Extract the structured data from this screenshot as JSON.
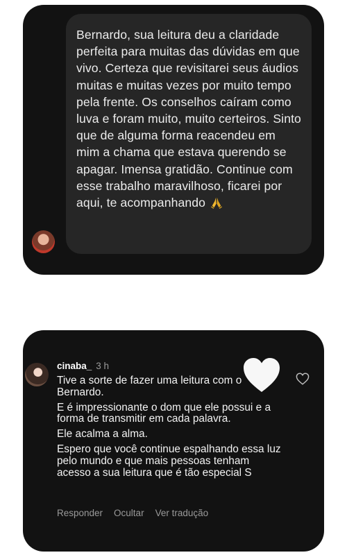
{
  "dm": {
    "message": "Bernardo, sua leitura deu a claridade perfeita para muitas das dúvidas em que vivo. Certeza que revisitarei seus áudios muitas e muitas vezes por muito tempo pela frente. Os conselhos caíram como luva e foram muito, muito certeiros. Sinto que de alguma forma reacendeu em mim a chama que estava querendo se apagar.  Imensa gratidão. Continue com esse trabalho maravilhoso, ficarei por aqui, te acompanhando",
    "emoji_icon": "praying-hands-icon"
  },
  "comment": {
    "username": "cinaba_",
    "time": "3 h",
    "paragraphs": [
      "Tive a sorte de fazer uma leitura com o Bernardo.",
      "E é impressionante o dom que ele possui e a forma de transmitir em cada palavra.",
      "Ele acalma a alma.",
      "Espero que você continue espalhando essa luz pelo mundo e que mais pessoas tenham acesso a sua leitura que é tão especial S"
    ],
    "actions": {
      "reply": "Responder",
      "hide": "Ocultar",
      "translate": "Ver tradução"
    },
    "like_icon": "heart-outline-icon",
    "overlay_icon": "white-heart-icon"
  },
  "colors": {
    "card_bg": "#121212",
    "bubble_bg": "#262626",
    "text_primary": "#ececec",
    "text_secondary": "#9a9a9a",
    "emoji_gold": "#f2b930"
  }
}
